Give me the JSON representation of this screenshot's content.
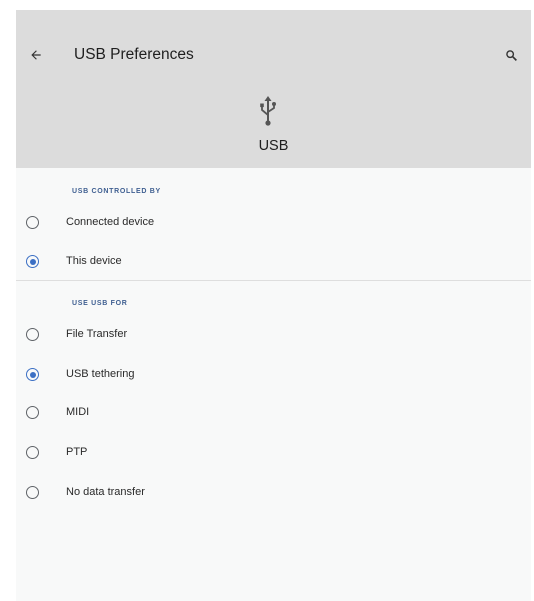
{
  "header": {
    "title": "USB Preferences",
    "usb_label": "USB",
    "back_icon": "arrow-back-icon",
    "search_icon": "search-icon",
    "background_color": "#dcdcdc"
  },
  "usb_controlled_by": {
    "header": "USB CONTROLLED BY",
    "options": [
      {
        "label": "Connected device",
        "selected": false
      },
      {
        "label": "This device",
        "selected": true
      }
    ]
  },
  "use_usb_for": {
    "header": "USE USB FOR",
    "options": [
      {
        "label": "File Transfer",
        "selected": false
      },
      {
        "label": "USB tethering",
        "selected": true
      },
      {
        "label": "MIDI",
        "selected": false
      },
      {
        "label": "PTP",
        "selected": false
      },
      {
        "label": "No data transfer",
        "selected": false
      }
    ]
  },
  "colors": {
    "accent": "#3b6fc4",
    "section_header": "#3f5f91"
  }
}
